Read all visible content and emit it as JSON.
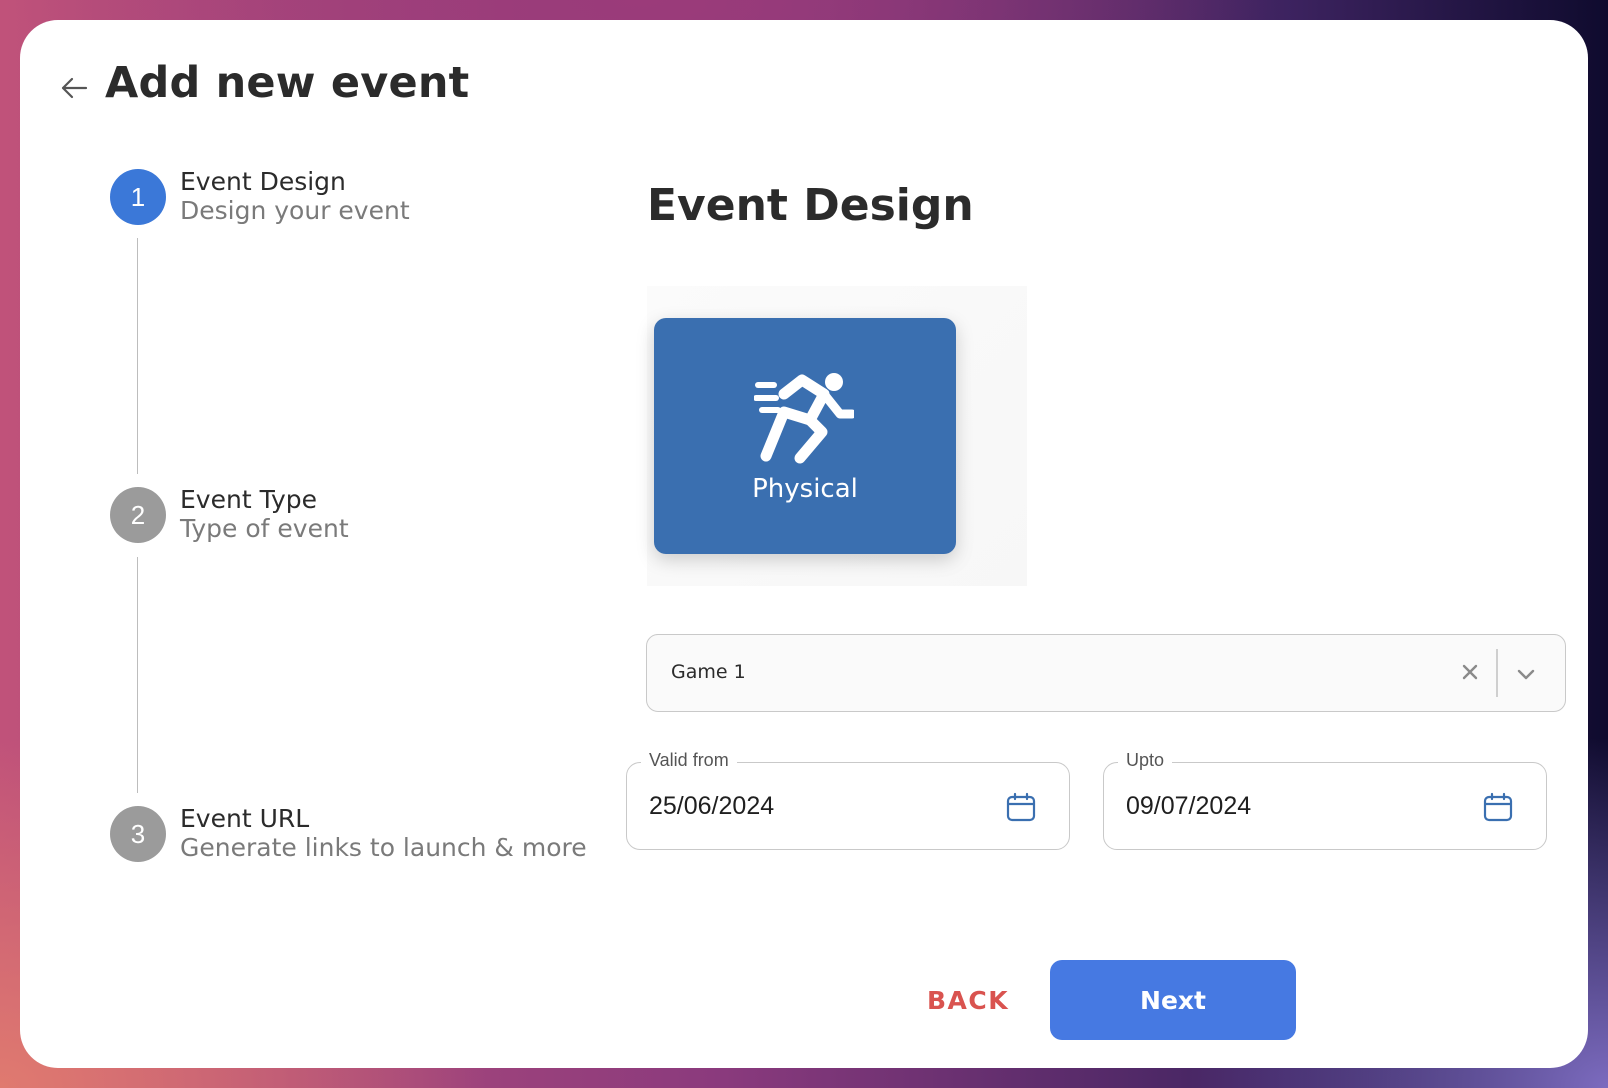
{
  "header": {
    "title": "Add new event"
  },
  "stepper": {
    "steps": [
      {
        "number": "1",
        "title": "Event Design",
        "subtitle": "Design your event",
        "state": "active"
      },
      {
        "number": "2",
        "title": "Event Type",
        "subtitle": "Type of event",
        "state": "inactive"
      },
      {
        "number": "3",
        "title": "Event URL",
        "subtitle": "Generate links to launch & more",
        "state": "inactive"
      }
    ]
  },
  "main": {
    "section_title": "Event Design",
    "design_tile": {
      "label": "Physical",
      "icon": "running-person-icon",
      "color": "#3a6fb0"
    },
    "game_select": {
      "value": "Game 1"
    },
    "valid_from": {
      "label": "Valid from",
      "value": "25/06/2024"
    },
    "upto": {
      "label": "Upto",
      "value": "09/07/2024"
    }
  },
  "actions": {
    "back_label": "BACK",
    "next_label": "Next",
    "back_color": "#d9534f",
    "next_color": "#4679e2"
  },
  "colors": {
    "active_step": "#3b78d8",
    "inactive_step": "#9b9b9b"
  }
}
